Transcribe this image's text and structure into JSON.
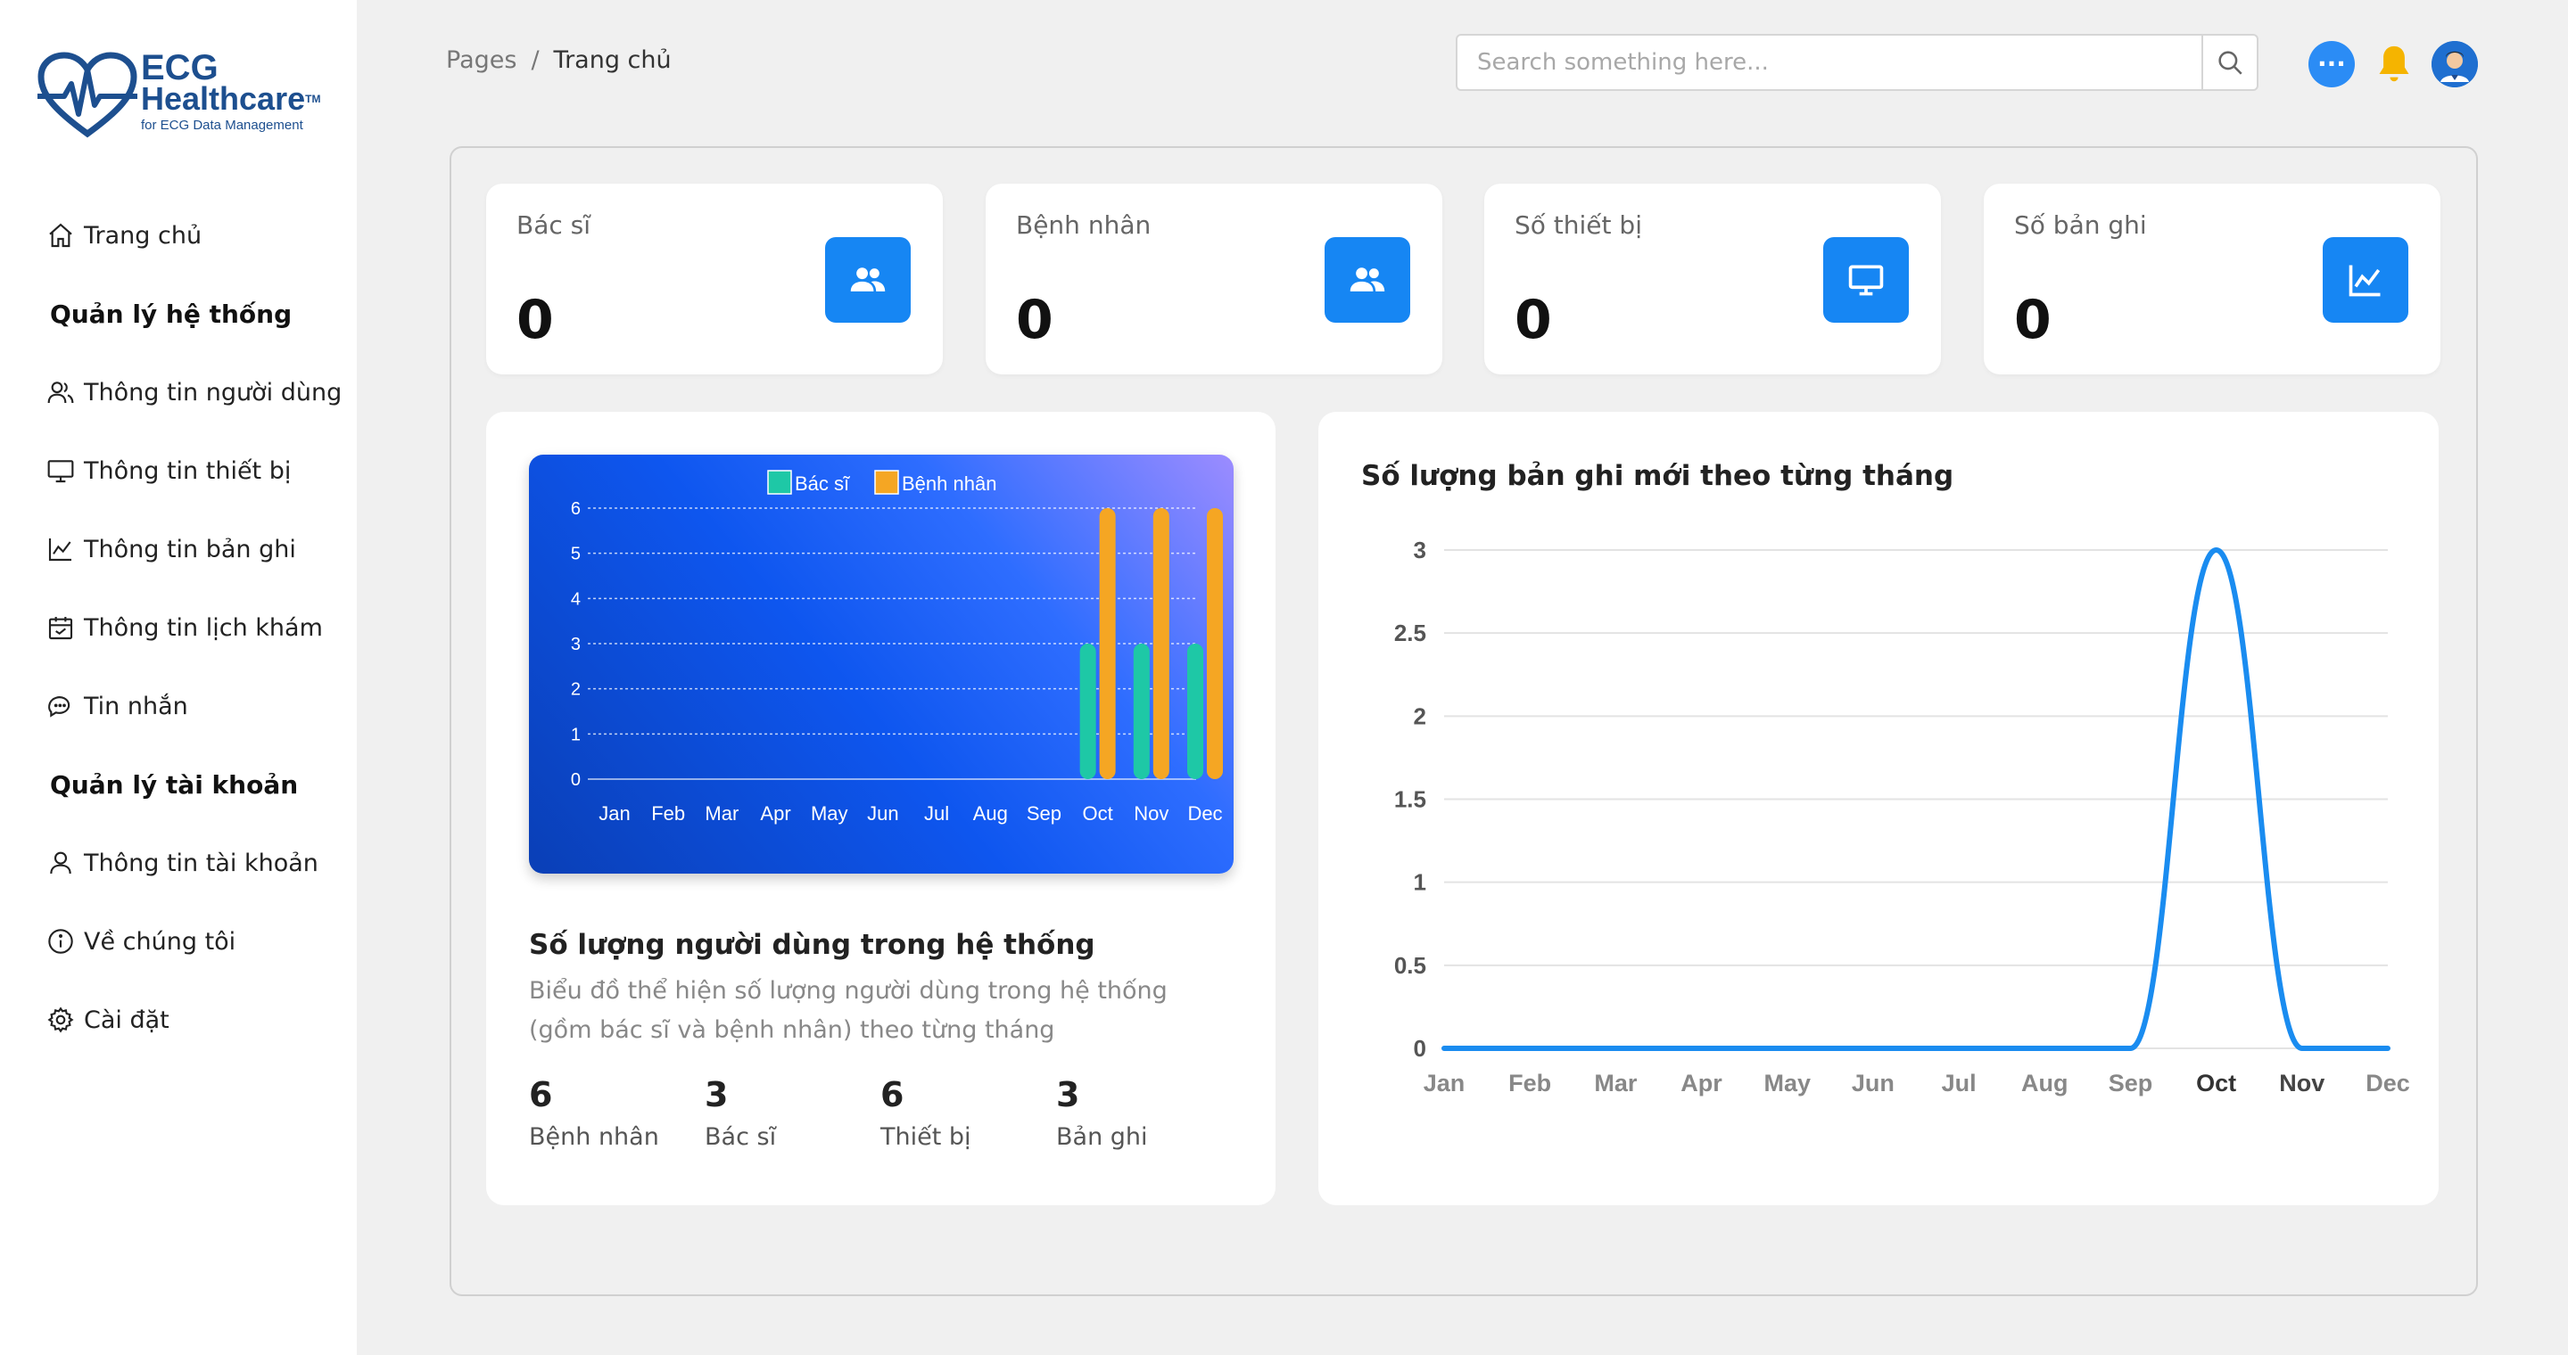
{
  "brand": {
    "name_line1": "ECG",
    "name_line2": "Healthcare",
    "trademark": "TM",
    "tagline": "for ECG Data Management"
  },
  "sidebar": {
    "items": [
      {
        "label": "Trang chủ",
        "icon": "home-icon"
      },
      {
        "section": "Quản lý hệ thống"
      },
      {
        "label": "Thông tin người dùng",
        "icon": "users-icon"
      },
      {
        "label": "Thông tin thiết bị",
        "icon": "monitor-icon"
      },
      {
        "label": "Thông tin bản ghi",
        "icon": "chart-line-icon"
      },
      {
        "label": "Thông tin lịch khám",
        "icon": "calendar-icon"
      },
      {
        "label": "Tin nhắn",
        "icon": "chat-icon"
      },
      {
        "section": "Quản lý tài khoản"
      },
      {
        "label": "Thông tin tài khoản",
        "icon": "user-icon"
      },
      {
        "label": "Về chúng tôi",
        "icon": "info-icon"
      },
      {
        "label": "Cài đặt",
        "icon": "gear-icon"
      }
    ]
  },
  "header": {
    "breadcrumb_root": "Pages",
    "breadcrumb_sep": "/",
    "breadcrumb_current": "Trang chủ",
    "search_placeholder": "Search something here...",
    "chat_glyph": "···"
  },
  "stats": [
    {
      "label": "Bác sĩ",
      "value": "0",
      "icon": "users-icon"
    },
    {
      "label": "Bệnh nhân",
      "value": "0",
      "icon": "users-icon"
    },
    {
      "label": "Số thiết bị",
      "value": "0",
      "icon": "monitor-icon"
    },
    {
      "label": "Số bản ghi",
      "value": "0",
      "icon": "chart-line-icon"
    }
  ],
  "users_card": {
    "title": "Số lượng người dùng trong hệ thống",
    "description": "Biểu đồ thể hiện số lượng người dùng trong hệ thống (gồm bác sĩ và bệnh nhân) theo từng tháng",
    "summary": [
      {
        "value": "6",
        "label": "Bệnh nhân"
      },
      {
        "value": "3",
        "label": "Bác sĩ"
      },
      {
        "value": "6",
        "label": "Thiết bị"
      },
      {
        "value": "3",
        "label": "Bản ghi"
      }
    ]
  },
  "records_card": {
    "title": "Số lượng bản ghi mới theo từng tháng"
  },
  "colors": {
    "accent": "#1686f3",
    "doctor_bar": "#1ec8a6",
    "patient_bar": "#f5a623",
    "line": "#1a8cf0"
  },
  "chart_data": [
    {
      "type": "bar",
      "categories": [
        "Jan",
        "Feb",
        "Mar",
        "Apr",
        "May",
        "Jun",
        "Jul",
        "Aug",
        "Sep",
        "Oct",
        "Nov",
        "Dec"
      ],
      "series": [
        {
          "name": "Bác sĩ",
          "values": [
            0,
            0,
            0,
            0,
            0,
            0,
            0,
            0,
            0,
            3,
            3,
            3
          ]
        },
        {
          "name": "Bệnh nhân",
          "values": [
            0,
            0,
            0,
            0,
            0,
            0,
            0,
            0,
            0,
            6,
            6,
            6
          ]
        }
      ],
      "ylim": [
        0,
        6
      ],
      "yticks": [
        "0",
        "1",
        "2",
        "3",
        "4",
        "5",
        "6"
      ],
      "grid": true,
      "legend": "top"
    },
    {
      "type": "line",
      "categories": [
        "Jan",
        "Feb",
        "Mar",
        "Apr",
        "May",
        "Jun",
        "Jul",
        "Aug",
        "Sep",
        "Oct",
        "Nov",
        "Dec"
      ],
      "series": [
        {
          "values": [
            0,
            0,
            0,
            0,
            0,
            0,
            0,
            0,
            0,
            3,
            0,
            0
          ]
        }
      ],
      "ylim": [
        0,
        3
      ],
      "yticks": [
        "0",
        "0.5",
        "1",
        "1.5",
        "2",
        "2.5",
        "3"
      ],
      "grid": true
    }
  ]
}
